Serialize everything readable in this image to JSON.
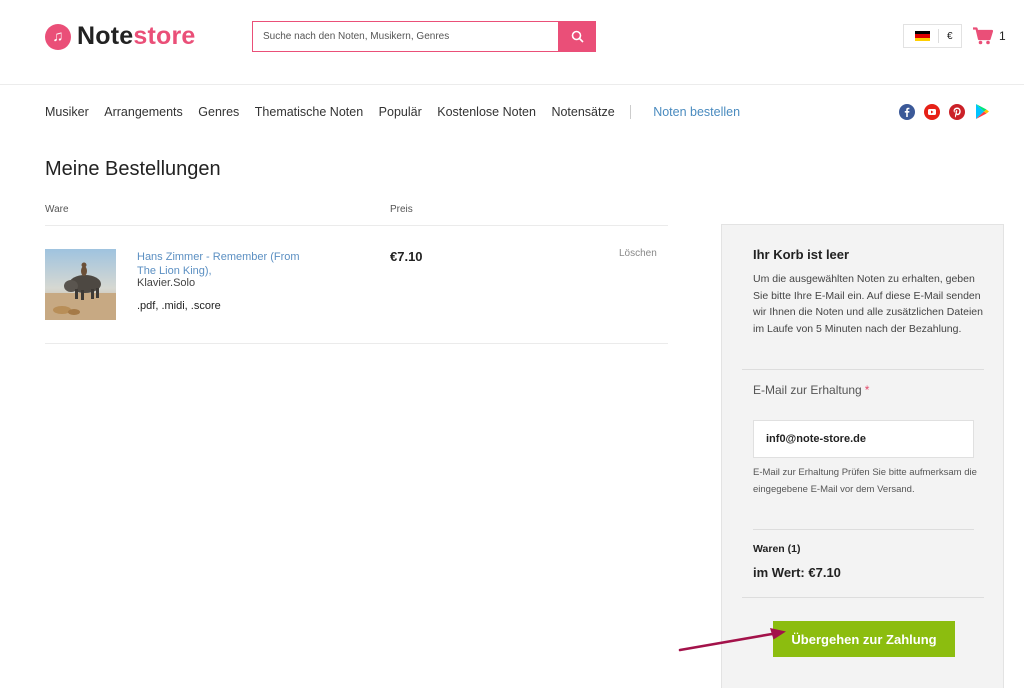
{
  "header": {
    "logo_part1": "Note",
    "logo_part2": "store",
    "search_placeholder": "Suche nach den Noten, Musikern, Genres",
    "currency": "€",
    "cart_count": "1",
    "brand_color": "#ea4f78"
  },
  "nav": {
    "items": [
      "Musiker",
      "Arrangements",
      "Genres",
      "Thematische Noten",
      "Populär",
      "Kostenlose Noten",
      "Notensätze"
    ],
    "highlight": "Noten bestellen"
  },
  "social": [
    "facebook-icon",
    "youtube-icon",
    "pinterest-icon",
    "google-play-icon"
  ],
  "main": {
    "title": "Meine Bestellungen",
    "col_ware": "Ware",
    "col_preis": "Preis",
    "item": {
      "title": "Hans Zimmer - Remember (From The Lion King),",
      "subtitle": "Klavier.Solo",
      "formats": ".pdf, .midi, .score",
      "price": "€7.10",
      "delete_label": "Löschen"
    }
  },
  "panel": {
    "title": "Ihr Korb ist leer",
    "description": "Um die ausgewählten Noten zu erhalten, geben Sie bitte Ihre E-Mail ein. Auf diese E-Mail senden wir Ihnen die Noten und alle zusätzlichen Dateien im Laufe von 5 Minuten nach der Bezahlung.",
    "email_label": "E-Mail zur Erhaltung",
    "required_mark": "*",
    "email_value": "inf0@note-store.de",
    "hint": "E-Mail zur Erhaltung Prüfen Sie bitte aufmerksam die eingegebene E-Mail vor dem Versand.",
    "items_count": "Waren (1)",
    "total": "im Wert: €7.10",
    "checkout_label": "Übergehen zur Zahlung",
    "checkout_color": "#8cbd0f"
  }
}
